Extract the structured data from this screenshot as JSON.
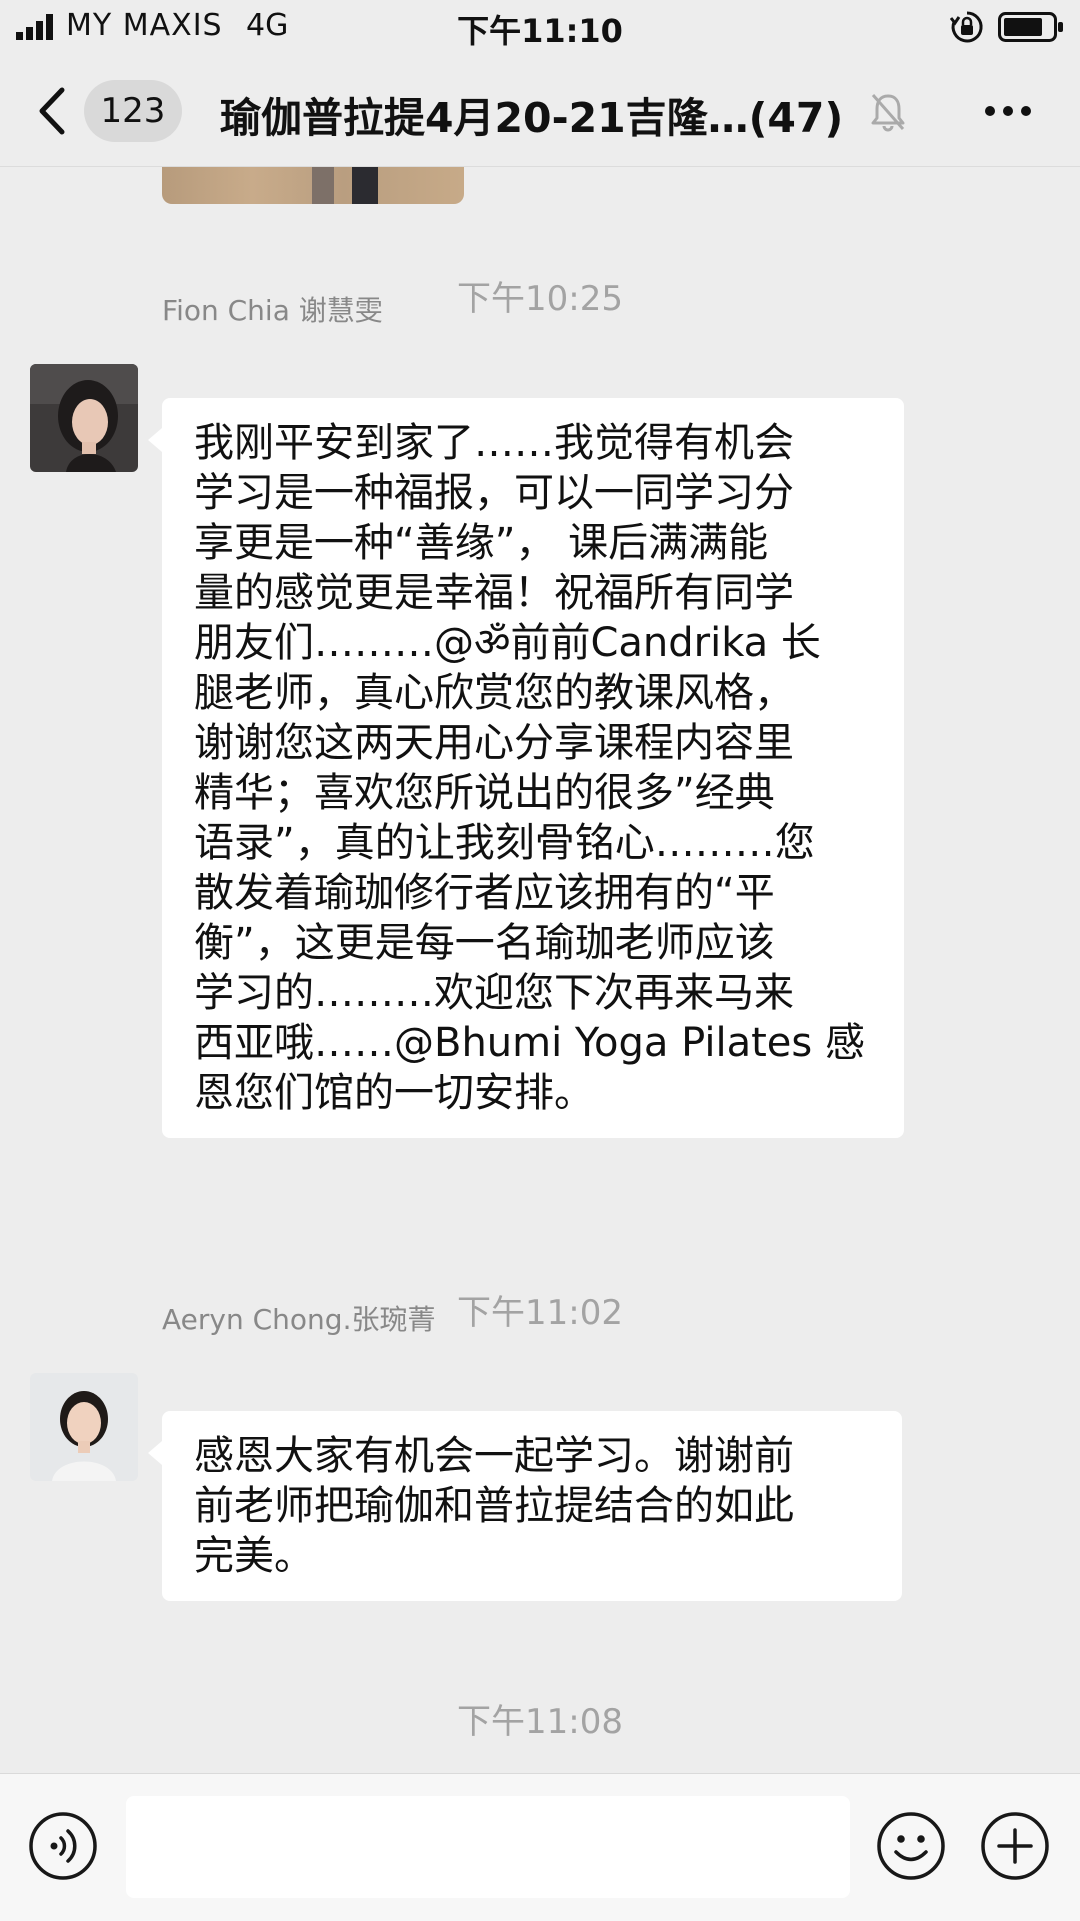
{
  "status_bar": {
    "carrier": "MY MAXIS",
    "network": "4G",
    "time": "下午11:10"
  },
  "nav": {
    "unread_count": "123",
    "title": "瑜伽普拉提4月20-21吉隆…(47)"
  },
  "chat": {
    "messages": [
      {
        "timestamp": "下午10:25",
        "sender": "Fion Chia 谢慧雯",
        "lines": [
          "我刚平安到家了……我觉得有机会",
          "学习是一种福报，可以一同学习分",
          "享更是一种“善缘”， 课后满满能",
          "量的感觉更是幸福！祝福所有同学",
          "朋友们………@ॐ前前Candrika 长",
          "腿老师，真心欣赏您的教课风格，",
          "谢谢您这两天用心分享课程内容里",
          "精华；喜欢您所说出的很多”经典",
          "语录”，真的让我刻骨铭心………您",
          "散发着瑜珈修行者应该拥有的“平",
          "衡”，这更是每一名瑜珈老师应该",
          "学习的………欢迎您下次再来马来",
          "西亚哦……@Bhumi Yoga Pilates 感",
          "恩您们馆的一切安排。"
        ]
      },
      {
        "timestamp": "下午11:02",
        "sender": "Aeryn Chong.张琬菁",
        "lines": [
          "感恩大家有机会一起学习。谢谢前",
          "前老师把瑜伽和普拉提结合的如此",
          "完美。"
        ]
      }
    ],
    "last_timestamp": "下午11:08"
  },
  "input": {
    "value": "",
    "placeholder": ""
  },
  "colors": {
    "background": "#ededed",
    "bubble": "#ffffff",
    "timestamp_text": "#a3a3a3",
    "sender_text": "#888888",
    "input_bar": "#f7f7f7"
  },
  "icons": {
    "signal": "signal-bars-icon",
    "orientation_lock": "orientation-lock-icon",
    "battery": "battery-icon",
    "back": "back-chevron-icon",
    "mute": "muted-bell-icon",
    "more": "more-dots-icon",
    "voice": "voice-input-icon",
    "emoji": "emoji-smile-icon",
    "plus": "plus-icon"
  }
}
